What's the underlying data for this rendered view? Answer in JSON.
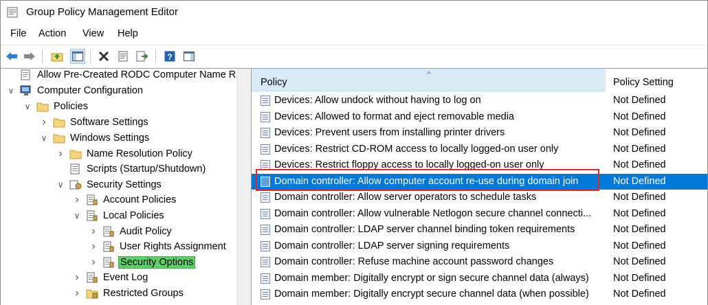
{
  "window": {
    "title": "Group Policy Management Editor"
  },
  "menu": [
    "File",
    "Action",
    "View",
    "Help"
  ],
  "toolbar": {
    "buttons": [
      "back-icon",
      "forward-icon",
      "up-folder-icon",
      "show-hide-tree-icon",
      "delete-icon",
      "properties-icon",
      "export-list-icon",
      "help-icon",
      "show-action-pane-icon"
    ]
  },
  "tree": {
    "items": [
      {
        "label": "Allow Pre-Created RODC Computer Name Re-U",
        "level": 0,
        "icon": "gpo-doc-icon",
        "chevron": ""
      },
      {
        "label": "Computer Configuration",
        "level": 0,
        "icon": "computer-icon",
        "chevron": "expanded"
      },
      {
        "label": "Policies",
        "level": 1,
        "icon": "folder-icon",
        "chevron": "expanded"
      },
      {
        "label": "Software Settings",
        "level": 2,
        "icon": "folder-icon",
        "chevron": "collapsed"
      },
      {
        "label": "Windows Settings",
        "level": 2,
        "icon": "folder-icon",
        "chevron": "expanded"
      },
      {
        "label": "Name Resolution Policy",
        "level": 3,
        "icon": "folder-icon",
        "chevron": "collapsed"
      },
      {
        "label": "Scripts (Startup/Shutdown)",
        "level": 3,
        "icon": "script-icon",
        "chevron": ""
      },
      {
        "label": "Security Settings",
        "level": 3,
        "icon": "security-icon",
        "chevron": "expanded"
      },
      {
        "label": "Account Policies",
        "level": 4,
        "icon": "policy-icon",
        "chevron": "collapsed"
      },
      {
        "label": "Local Policies",
        "level": 4,
        "icon": "policy-icon",
        "chevron": "expanded"
      },
      {
        "label": "Audit Policy",
        "level": 5,
        "icon": "policy-icon",
        "chevron": "collapsed"
      },
      {
        "label": "User Rights Assignment",
        "level": 5,
        "icon": "policy-icon",
        "chevron": "collapsed"
      },
      {
        "label": "Security Options",
        "level": 5,
        "icon": "policy-icon",
        "chevron": "collapsed",
        "selected": true
      },
      {
        "label": "Event Log",
        "level": 4,
        "icon": "policy-icon",
        "chevron": "collapsed"
      },
      {
        "label": "Restricted Groups",
        "level": 4,
        "icon": "restricted-groups-icon",
        "chevron": "collapsed"
      }
    ]
  },
  "list": {
    "columns": {
      "policy": "Policy",
      "setting": "Policy Setting"
    },
    "rows": [
      {
        "policy": "Devices: Allow undock without having to log on",
        "setting": "Not Defined"
      },
      {
        "policy": "Devices: Allowed to format and eject removable media",
        "setting": "Not Defined"
      },
      {
        "policy": "Devices: Prevent users from installing printer drivers",
        "setting": "Not Defined"
      },
      {
        "policy": "Devices: Restrict CD-ROM access to locally logged-on user only",
        "setting": "Not Defined"
      },
      {
        "policy": "Devices: Restrict floppy access to locally logged-on user only",
        "setting": "Not Defined"
      },
      {
        "policy": "Domain controller: Allow computer account re-use during domain join",
        "setting": "Not Defined",
        "selected": true
      },
      {
        "policy": "Domain controller: Allow server operators to schedule tasks",
        "setting": "Not Defined"
      },
      {
        "policy": "Domain controller: Allow vulnerable Netlogon secure channel connecti...",
        "setting": "Not Defined"
      },
      {
        "policy": "Domain controller: LDAP server channel binding token requirements",
        "setting": "Not Defined"
      },
      {
        "policy": "Domain controller: LDAP server signing requirements",
        "setting": "Not Defined"
      },
      {
        "policy": "Domain controller: Refuse machine account password changes",
        "setting": "Not Defined"
      },
      {
        "policy": "Domain member: Digitally encrypt or sign secure channel data (always)",
        "setting": "Not Defined"
      },
      {
        "policy": "Domain member: Digitally encrypt secure channel data (when possible)",
        "setting": "Not Defined"
      }
    ]
  },
  "colors": {
    "selection": "#0078d7",
    "tree_selection": "#5fd069",
    "header_hover": "#d9eaf7",
    "annotation": "#d92b2b"
  }
}
